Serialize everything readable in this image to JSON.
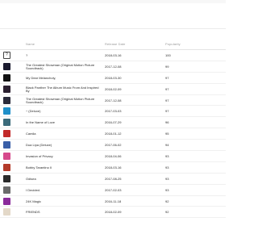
{
  "table": {
    "headers": {
      "name": "Name",
      "release_date": "Release Date",
      "popularity": "Popularity"
    },
    "rows": [
      {
        "name": "?",
        "date": "2018-03-16",
        "popularity": "100",
        "thumb_color": "#ffffff",
        "thumb_glyph": "?",
        "two_line": false
      },
      {
        "name": "The Greatest Showman (Original Motion Picture Soundtrack)",
        "date": "2017-12-08",
        "popularity": "99",
        "thumb_color": "#1a1a2e",
        "two_line": true
      },
      {
        "name": "My Dear Melancholy,",
        "date": "2018-03-30",
        "popularity": "97",
        "thumb_color": "#111111",
        "two_line": false
      },
      {
        "name": "Black Panther The Album Music From And Inspired By",
        "date": "2018-02-09",
        "popularity": "97",
        "thumb_color": "#2b2030",
        "two_line": true
      },
      {
        "name": "The Greatest Showman (Original Motion Picture Soundtrack)",
        "date": "2017-12-08",
        "popularity": "97",
        "thumb_color": "#2a2a3a",
        "two_line": true
      },
      {
        "name": "÷ (Deluxe)",
        "date": "2017-03-03",
        "popularity": "97",
        "thumb_color": "#1f8fc9",
        "two_line": false
      },
      {
        "name": "In the Name of Love",
        "date": "2016-07-29",
        "popularity": "96",
        "thumb_color": "#3a6a7a",
        "two_line": false
      },
      {
        "name": "Camila",
        "date": "2018-01-12",
        "popularity": "95",
        "thumb_color": "#c22a2a",
        "two_line": false
      },
      {
        "name": "Dua Lipa (Deluxe)",
        "date": "2017-06-02",
        "popularity": "94",
        "thumb_color": "#3a5fa8",
        "two_line": false
      },
      {
        "name": "Invasion of Privacy",
        "date": "2018-04-06",
        "popularity": "93",
        "thumb_color": "#d64a8c",
        "two_line": false
      },
      {
        "name": "Bobby Tarantino II",
        "date": "2018-03-16",
        "popularity": "93",
        "thumb_color": "#b33a2a",
        "two_line": false
      },
      {
        "name": "Odisea",
        "date": "2017-08-25",
        "popularity": "93",
        "thumb_color": "#2a2a2a",
        "two_line": false
      },
      {
        "name": "I Decided.",
        "date": "2017-02-03",
        "popularity": "93",
        "thumb_color": "#6a6a6a",
        "two_line": false
      },
      {
        "name": "24K Magic",
        "date": "2016-11-18",
        "popularity": "92",
        "thumb_color": "#8a2a9a",
        "two_line": false
      },
      {
        "name": "FRIENDS",
        "date": "2018-02-09",
        "popularity": "92",
        "thumb_color": "#e3d8c8",
        "two_line": false
      }
    ]
  }
}
